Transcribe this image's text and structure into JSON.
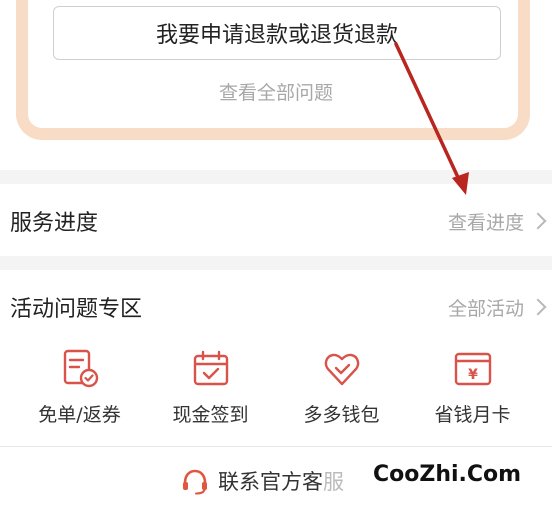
{
  "help_card": {
    "refund_button_label": "我要申请退款或退货退款",
    "view_all_questions": "查看全部问题"
  },
  "service_progress": {
    "title": "服务进度",
    "link_label": "查看进度"
  },
  "activity_zone": {
    "title": "活动问题专区",
    "link_label": "全部活动",
    "items": [
      {
        "label": "免单/返券",
        "icon": "document-check-icon"
      },
      {
        "label": "现金签到",
        "icon": "calendar-check-icon"
      },
      {
        "label": "多多钱包",
        "icon": "heart-wallet-icon"
      },
      {
        "label": "省钱月卡",
        "icon": "yen-card-icon"
      }
    ]
  },
  "contact": {
    "label": "联系官方客",
    "label_faded": "服"
  },
  "watermark": {
    "text": "CooZhi.Com"
  },
  "colors": {
    "accent": "#d9534a",
    "card_border": "#f8dcc6",
    "annotation_arrow": "#b8261f",
    "muted_text": "#a8a8a8"
  }
}
